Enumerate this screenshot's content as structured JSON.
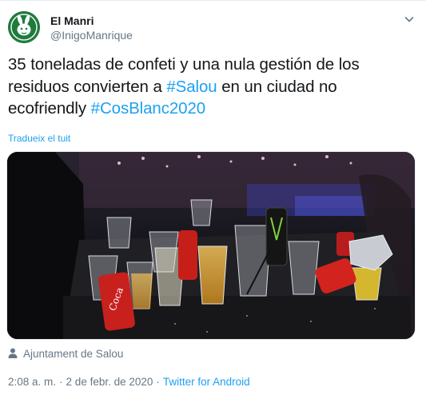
{
  "user": {
    "name": "El Manri",
    "handle": "@InigoManrique"
  },
  "tweet": {
    "text_line1": "35 toneladas de confeti y una nula gestión de los",
    "text_line2_pre": "residuos convierten a ",
    "hashtag_salou": "#Salou",
    "text_line2_post": " en un ciudad no",
    "text_line3_pre": "ecofriendly ",
    "hashtag_cosblanc": "#CosBlanc2020",
    "translate_label": "Tradueix el tuit"
  },
  "location": "Ajuntament de Salou",
  "meta": {
    "time": "2:08 a. m.",
    "date": "2 de febr. de 2020",
    "separator": "·",
    "source": "Twitter for Android"
  },
  "icons": {
    "avatar": "rabbit-logo-icon",
    "menu": "chevron-down-icon",
    "location": "person-icon"
  },
  "colors": {
    "link": "#1da1f2",
    "secondary_text": "#657786",
    "primary_text": "#14171a",
    "avatar_bg": "#1f7a3d"
  }
}
